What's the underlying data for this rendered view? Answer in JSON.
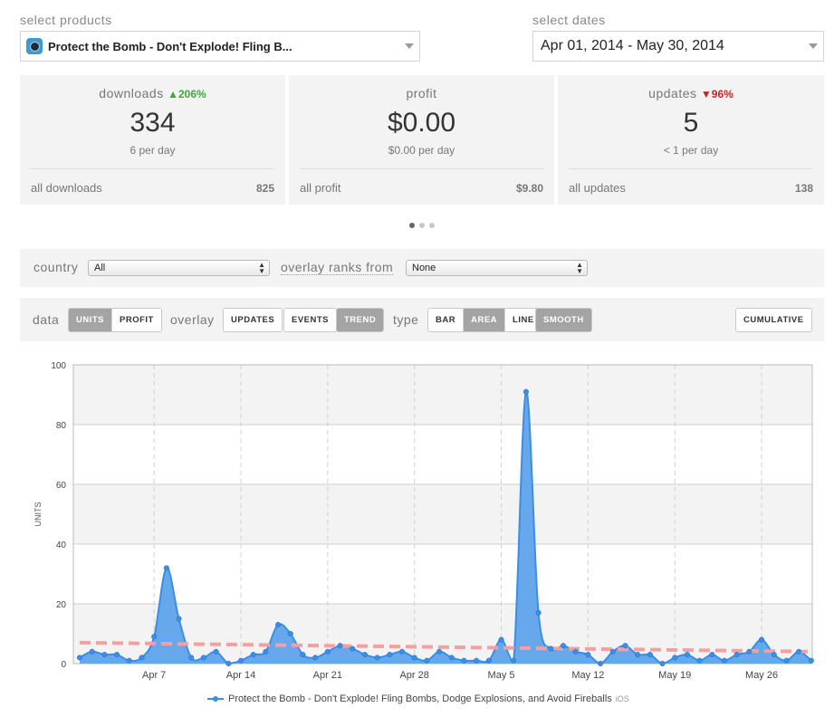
{
  "selectors": {
    "products_label": "select products",
    "product_value": "Protect the Bomb - Don't Explode! Fling B...",
    "dates_label": "select dates",
    "dates_value": "Apr 01, 2014 - May 30, 2014"
  },
  "cards": [
    {
      "title": "downloads",
      "delta": "206%",
      "delta_dir": "up",
      "value": "334",
      "sub": "6 per day",
      "foot_label": "all downloads",
      "foot_value": "825"
    },
    {
      "title": "profit",
      "delta": "",
      "delta_dir": "",
      "value": "$0.00",
      "sub": "$0.00 per day",
      "foot_label": "all profit",
      "foot_value": "$9.80"
    },
    {
      "title": "updates",
      "delta": "96%",
      "delta_dir": "down",
      "value": "5",
      "sub": "< 1 per day",
      "foot_label": "all updates",
      "foot_value": "138"
    }
  ],
  "pager": {
    "count": 3,
    "active": 0
  },
  "filters": {
    "country_label": "country",
    "country_value": "All",
    "overlay_label": "overlay ranks from",
    "overlay_value": "None"
  },
  "toolbar": {
    "data_label": "data",
    "data_buttons": [
      "UNITS",
      "PROFIT"
    ],
    "overlay_label": "overlay",
    "overlay_buttons": [
      "UPDATES",
      "EVENTS",
      "TREND"
    ],
    "type_label": "type",
    "type_buttons": [
      "BAR",
      "AREA",
      "LINE"
    ],
    "smooth": "SMOOTH",
    "cumulative": "CUMULATIVE"
  },
  "colors": {
    "series": "#3a8ee6",
    "series_fill": "#5fa3ec",
    "trend": "#f4a0a0",
    "active_button": "#a4a4a4"
  },
  "chart_data": {
    "type": "area",
    "smooth": true,
    "ylabel": "UNITS",
    "ylim": [
      0,
      100
    ],
    "yticks": [
      0,
      20,
      40,
      60,
      80,
      100
    ],
    "x_start": "2014-04-01",
    "x_end": "2014-05-30",
    "x_ticks": [
      "Apr 7",
      "Apr 14",
      "Apr 21",
      "Apr 28",
      "May 5",
      "May 12",
      "May 19",
      "May 26"
    ],
    "x_tick_dates": [
      "2014-04-07",
      "2014-04-14",
      "2014-04-21",
      "2014-04-28",
      "2014-05-05",
      "2014-05-12",
      "2014-05-19",
      "2014-05-26"
    ],
    "dates": [
      "2014-04-01",
      "2014-04-02",
      "2014-04-03",
      "2014-04-04",
      "2014-04-05",
      "2014-04-06",
      "2014-04-07",
      "2014-04-08",
      "2014-04-09",
      "2014-04-10",
      "2014-04-11",
      "2014-04-12",
      "2014-04-13",
      "2014-04-14",
      "2014-04-15",
      "2014-04-16",
      "2014-04-17",
      "2014-04-18",
      "2014-04-19",
      "2014-04-20",
      "2014-04-21",
      "2014-04-22",
      "2014-04-23",
      "2014-04-24",
      "2014-04-25",
      "2014-04-26",
      "2014-04-27",
      "2014-04-28",
      "2014-04-29",
      "2014-04-30",
      "2014-05-01",
      "2014-05-02",
      "2014-05-03",
      "2014-05-04",
      "2014-05-05",
      "2014-05-06",
      "2014-05-07",
      "2014-05-08",
      "2014-05-09",
      "2014-05-10",
      "2014-05-11",
      "2014-05-12",
      "2014-05-13",
      "2014-05-14",
      "2014-05-15",
      "2014-05-16",
      "2014-05-17",
      "2014-05-18",
      "2014-05-19",
      "2014-05-20",
      "2014-05-21",
      "2014-05-22",
      "2014-05-23",
      "2014-05-24",
      "2014-05-25",
      "2014-05-26",
      "2014-05-27",
      "2014-05-28",
      "2014-05-29",
      "2014-05-30"
    ],
    "series": [
      {
        "name": "Protect the Bomb - Don't Explode! Fling Bombs, Dodge Explosions, and Avoid Fireballs",
        "platform": "iOS",
        "values": [
          2,
          4,
          3,
          3,
          1,
          2,
          9,
          32,
          15,
          2,
          2,
          4,
          0,
          1,
          3,
          4,
          13,
          10,
          3,
          2,
          4,
          6,
          5,
          3,
          2,
          3,
          4,
          2,
          1,
          4,
          2,
          1,
          1,
          1,
          8,
          1,
          91,
          17,
          5,
          6,
          4,
          3,
          0,
          4,
          6,
          3,
          3,
          0,
          2,
          3,
          1,
          3,
          1,
          3,
          4,
          8,
          3,
          1,
          4,
          1
        ]
      }
    ],
    "trend": {
      "start": 7,
      "end": 4
    },
    "legend_position": "bottom-center",
    "grid": true
  }
}
